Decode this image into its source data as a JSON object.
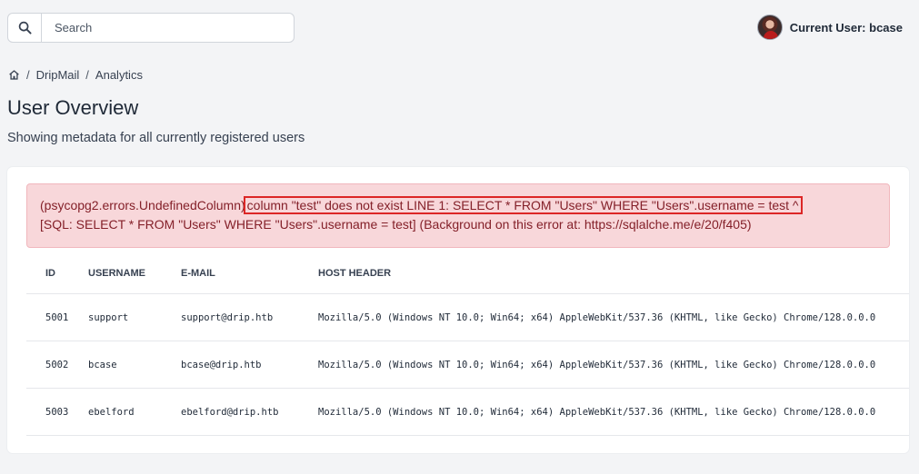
{
  "search": {
    "placeholder": "Search"
  },
  "user": {
    "label": "Current User: bcase"
  },
  "breadcrumb": {
    "items": [
      "DripMail",
      "Analytics"
    ]
  },
  "page": {
    "title": "User Overview",
    "subtitle": "Showing metadata for all currently registered users"
  },
  "alert": {
    "prefix": "(psycopg2.errors.UndefinedColumn)",
    "highlight": "column \"test\" does not exist LINE 1: SELECT * FROM \"Users\" WHERE \"Users\".username = test ^",
    "line2": "[SQL: SELECT * FROM \"Users\" WHERE \"Users\".username = test] (Background on this error at: https://sqlalche.me/e/20/f405)"
  },
  "table": {
    "headers": [
      "ID",
      "USERNAME",
      "E-MAIL",
      "HOST HEADER"
    ],
    "rows": [
      [
        "5001",
        "support",
        "support@drip.htb",
        "Mozilla/5.0 (Windows NT 10.0; Win64; x64) AppleWebKit/537.36 (KHTML, like Gecko) Chrome/128.0.0.0"
      ],
      [
        "5002",
        "bcase",
        "bcase@drip.htb",
        "Mozilla/5.0 (Windows NT 10.0; Win64; x64) AppleWebKit/537.36 (KHTML, like Gecko) Chrome/128.0.0.0"
      ],
      [
        "5003",
        "ebelford",
        "ebelford@drip.htb",
        "Mozilla/5.0 (Windows NT 10.0; Win64; x64) AppleWebKit/537.36 (KHTML, like Gecko) Chrome/128.0.0.0"
      ]
    ]
  },
  "colors": {
    "alert_bg": "#f8d7da",
    "alert_text": "#842029",
    "highlight_border": "#dc2626"
  }
}
